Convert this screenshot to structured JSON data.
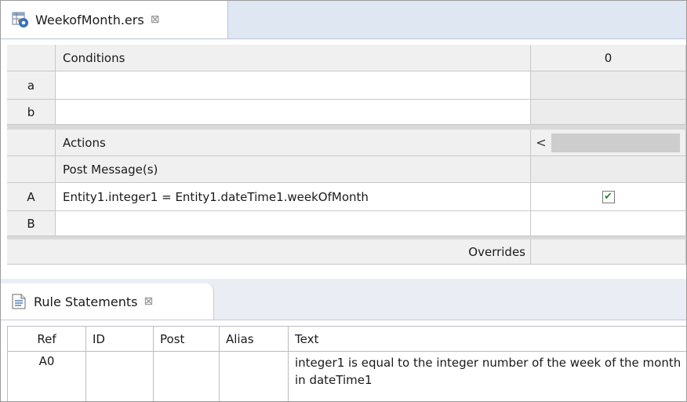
{
  "editor": {
    "tab_label": "WeekofMonth.ers",
    "tab_close": "⊠"
  },
  "conditions": {
    "header_label": "Conditions",
    "column_header": "0",
    "rows": [
      {
        "index": "a",
        "text": ""
      },
      {
        "index": "b",
        "text": ""
      }
    ]
  },
  "actions": {
    "header_label": "Actions",
    "scroll_left": "<",
    "post_message_label": "Post Message(s)",
    "rows": [
      {
        "index": "A",
        "text": "Entity1.integer1 = Entity1.dateTime1.weekOfMonth",
        "checked": true,
        "check_glyph": "✔"
      },
      {
        "index": "B",
        "text": "",
        "checked": false
      }
    ],
    "overrides_label": "Overrides"
  },
  "rule_statements": {
    "tab_label": "Rule Statements",
    "tab_close": "⊠",
    "columns": [
      "Ref",
      "ID",
      "Post",
      "Alias",
      "Text"
    ],
    "rows": [
      {
        "ref": "A0",
        "id": "",
        "post": "",
        "alias": "",
        "text": "integer1 is equal to the integer number of the week of the month in dateTime1"
      }
    ]
  },
  "colors": {
    "tab_bar": "#dfe7f3",
    "header_bg": "#f0f0f0",
    "gray_cell": "#ececec",
    "check_green": "#2f8a2f"
  }
}
